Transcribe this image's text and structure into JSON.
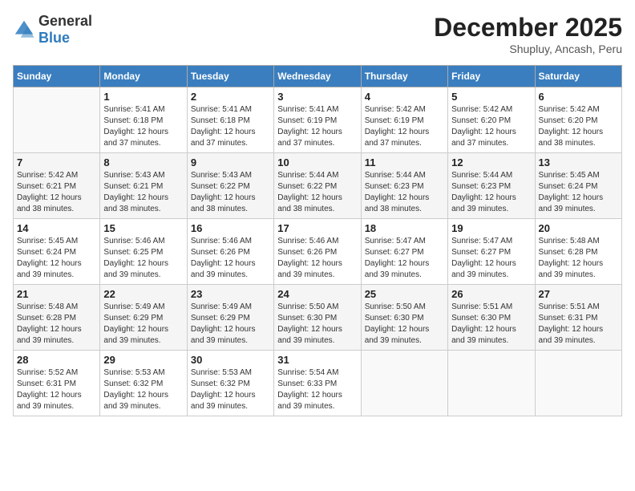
{
  "header": {
    "logo_general": "General",
    "logo_blue": "Blue",
    "month": "December 2025",
    "location": "Shupluy, Ancash, Peru"
  },
  "weekdays": [
    "Sunday",
    "Monday",
    "Tuesday",
    "Wednesday",
    "Thursday",
    "Friday",
    "Saturday"
  ],
  "weeks": [
    [
      {
        "day": "",
        "info": ""
      },
      {
        "day": "1",
        "info": "Sunrise: 5:41 AM\nSunset: 6:18 PM\nDaylight: 12 hours and 37 minutes."
      },
      {
        "day": "2",
        "info": "Sunrise: 5:41 AM\nSunset: 6:18 PM\nDaylight: 12 hours and 37 minutes."
      },
      {
        "day": "3",
        "info": "Sunrise: 5:41 AM\nSunset: 6:19 PM\nDaylight: 12 hours and 37 minutes."
      },
      {
        "day": "4",
        "info": "Sunrise: 5:42 AM\nSunset: 6:19 PM\nDaylight: 12 hours and 37 minutes."
      },
      {
        "day": "5",
        "info": "Sunrise: 5:42 AM\nSunset: 6:20 PM\nDaylight: 12 hours and 37 minutes."
      },
      {
        "day": "6",
        "info": "Sunrise: 5:42 AM\nSunset: 6:20 PM\nDaylight: 12 hours and 38 minutes."
      }
    ],
    [
      {
        "day": "7",
        "info": "Sunrise: 5:42 AM\nSunset: 6:21 PM\nDaylight: 12 hours and 38 minutes."
      },
      {
        "day": "8",
        "info": "Sunrise: 5:43 AM\nSunset: 6:21 PM\nDaylight: 12 hours and 38 minutes."
      },
      {
        "day": "9",
        "info": "Sunrise: 5:43 AM\nSunset: 6:22 PM\nDaylight: 12 hours and 38 minutes."
      },
      {
        "day": "10",
        "info": "Sunrise: 5:44 AM\nSunset: 6:22 PM\nDaylight: 12 hours and 38 minutes."
      },
      {
        "day": "11",
        "info": "Sunrise: 5:44 AM\nSunset: 6:23 PM\nDaylight: 12 hours and 38 minutes."
      },
      {
        "day": "12",
        "info": "Sunrise: 5:44 AM\nSunset: 6:23 PM\nDaylight: 12 hours and 39 minutes."
      },
      {
        "day": "13",
        "info": "Sunrise: 5:45 AM\nSunset: 6:24 PM\nDaylight: 12 hours and 39 minutes."
      }
    ],
    [
      {
        "day": "14",
        "info": "Sunrise: 5:45 AM\nSunset: 6:24 PM\nDaylight: 12 hours and 39 minutes."
      },
      {
        "day": "15",
        "info": "Sunrise: 5:46 AM\nSunset: 6:25 PM\nDaylight: 12 hours and 39 minutes."
      },
      {
        "day": "16",
        "info": "Sunrise: 5:46 AM\nSunset: 6:26 PM\nDaylight: 12 hours and 39 minutes."
      },
      {
        "day": "17",
        "info": "Sunrise: 5:46 AM\nSunset: 6:26 PM\nDaylight: 12 hours and 39 minutes."
      },
      {
        "day": "18",
        "info": "Sunrise: 5:47 AM\nSunset: 6:27 PM\nDaylight: 12 hours and 39 minutes."
      },
      {
        "day": "19",
        "info": "Sunrise: 5:47 AM\nSunset: 6:27 PM\nDaylight: 12 hours and 39 minutes."
      },
      {
        "day": "20",
        "info": "Sunrise: 5:48 AM\nSunset: 6:28 PM\nDaylight: 12 hours and 39 minutes."
      }
    ],
    [
      {
        "day": "21",
        "info": "Sunrise: 5:48 AM\nSunset: 6:28 PM\nDaylight: 12 hours and 39 minutes."
      },
      {
        "day": "22",
        "info": "Sunrise: 5:49 AM\nSunset: 6:29 PM\nDaylight: 12 hours and 39 minutes."
      },
      {
        "day": "23",
        "info": "Sunrise: 5:49 AM\nSunset: 6:29 PM\nDaylight: 12 hours and 39 minutes."
      },
      {
        "day": "24",
        "info": "Sunrise: 5:50 AM\nSunset: 6:30 PM\nDaylight: 12 hours and 39 minutes."
      },
      {
        "day": "25",
        "info": "Sunrise: 5:50 AM\nSunset: 6:30 PM\nDaylight: 12 hours and 39 minutes."
      },
      {
        "day": "26",
        "info": "Sunrise: 5:51 AM\nSunset: 6:30 PM\nDaylight: 12 hours and 39 minutes."
      },
      {
        "day": "27",
        "info": "Sunrise: 5:51 AM\nSunset: 6:31 PM\nDaylight: 12 hours and 39 minutes."
      }
    ],
    [
      {
        "day": "28",
        "info": "Sunrise: 5:52 AM\nSunset: 6:31 PM\nDaylight: 12 hours and 39 minutes."
      },
      {
        "day": "29",
        "info": "Sunrise: 5:53 AM\nSunset: 6:32 PM\nDaylight: 12 hours and 39 minutes."
      },
      {
        "day": "30",
        "info": "Sunrise: 5:53 AM\nSunset: 6:32 PM\nDaylight: 12 hours and 39 minutes."
      },
      {
        "day": "31",
        "info": "Sunrise: 5:54 AM\nSunset: 6:33 PM\nDaylight: 12 hours and 39 minutes."
      },
      {
        "day": "",
        "info": ""
      },
      {
        "day": "",
        "info": ""
      },
      {
        "day": "",
        "info": ""
      }
    ]
  ]
}
